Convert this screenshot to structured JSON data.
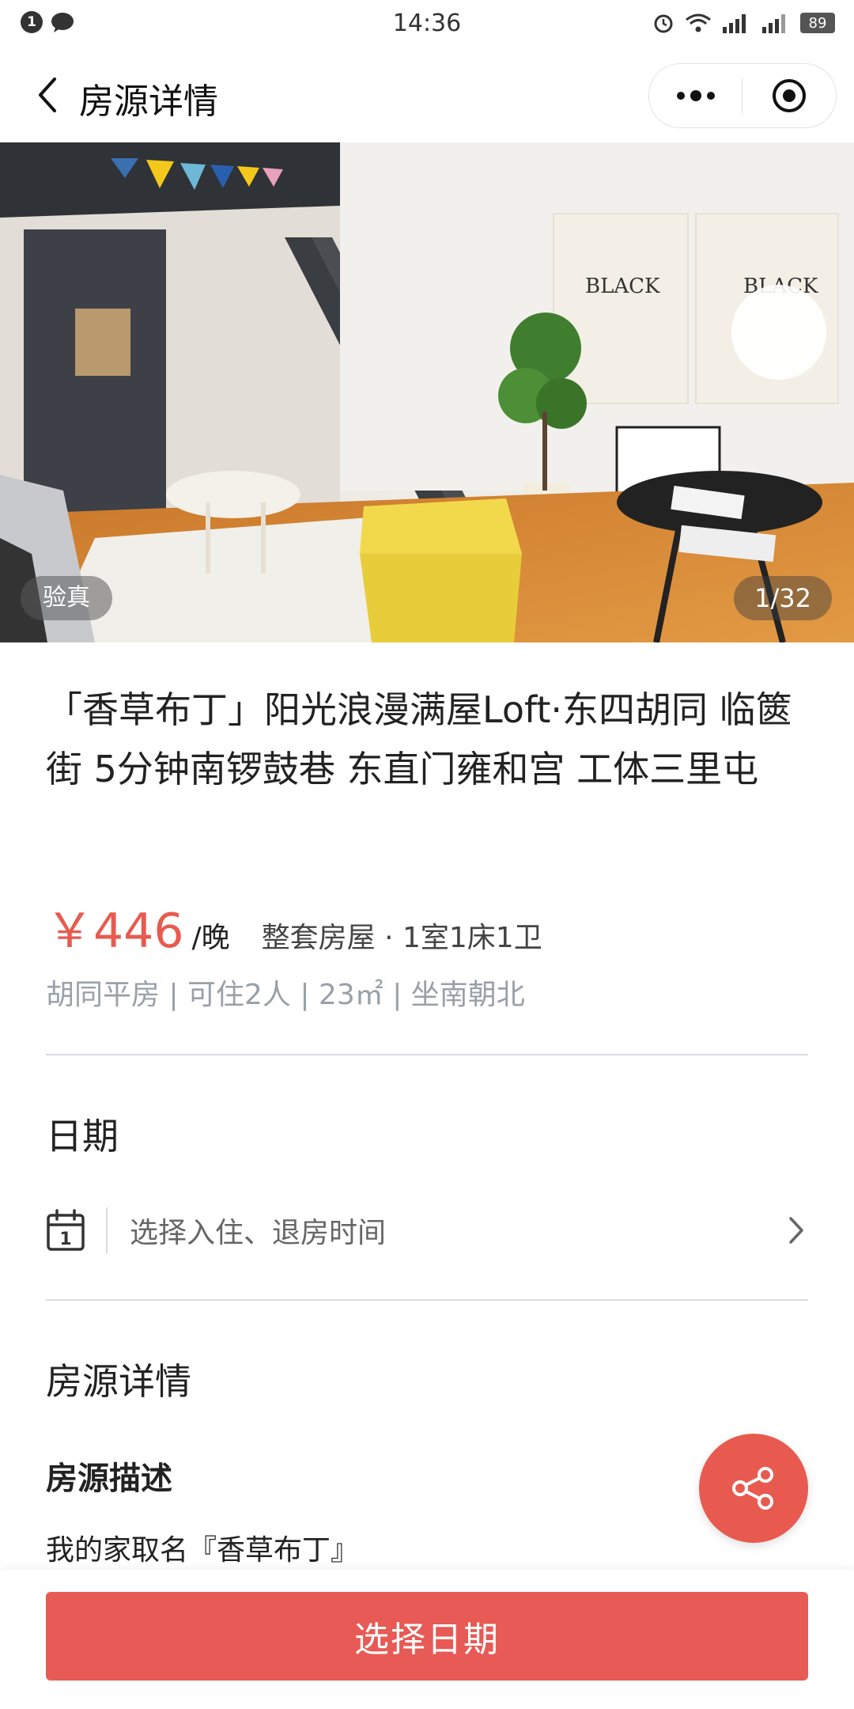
{
  "status_bar": {
    "notification_count": "1",
    "time": "14:36",
    "battery": "89"
  },
  "nav": {
    "title": "房源详情"
  },
  "gallery": {
    "verified_badge": "验真",
    "counter": "1/32"
  },
  "listing": {
    "title": "「香草布丁」阳光浪漫满屋Loft·东四胡同 临篋街 5分钟南锣鼓巷 东直门雍和宫 工体三里屯",
    "price": "￥446",
    "price_unit": "/晚",
    "room_type": "整套房屋 · 1室1床1卫",
    "attributes": "胡同平房 | 可住2人 | 23㎡ | 坐南朝北"
  },
  "date_section": {
    "title": "日期",
    "placeholder": "选择入住、退房时间",
    "calendar_day": "1"
  },
  "details_section": {
    "title": "房源详情",
    "description_heading": "房源描述",
    "description_text": "我的家取名『香草布丁』"
  },
  "cta": {
    "label": "选择日期"
  },
  "colors": {
    "accent": "#e85a4f",
    "muted_text": "#9aa0a8",
    "divider": "#d9dde2"
  },
  "icons": {
    "back": "chevron-left-icon",
    "more": "more-dots-icon",
    "target": "target-icon",
    "calendar": "calendar-icon",
    "chevron": "chevron-right-icon",
    "share": "share-icon"
  }
}
